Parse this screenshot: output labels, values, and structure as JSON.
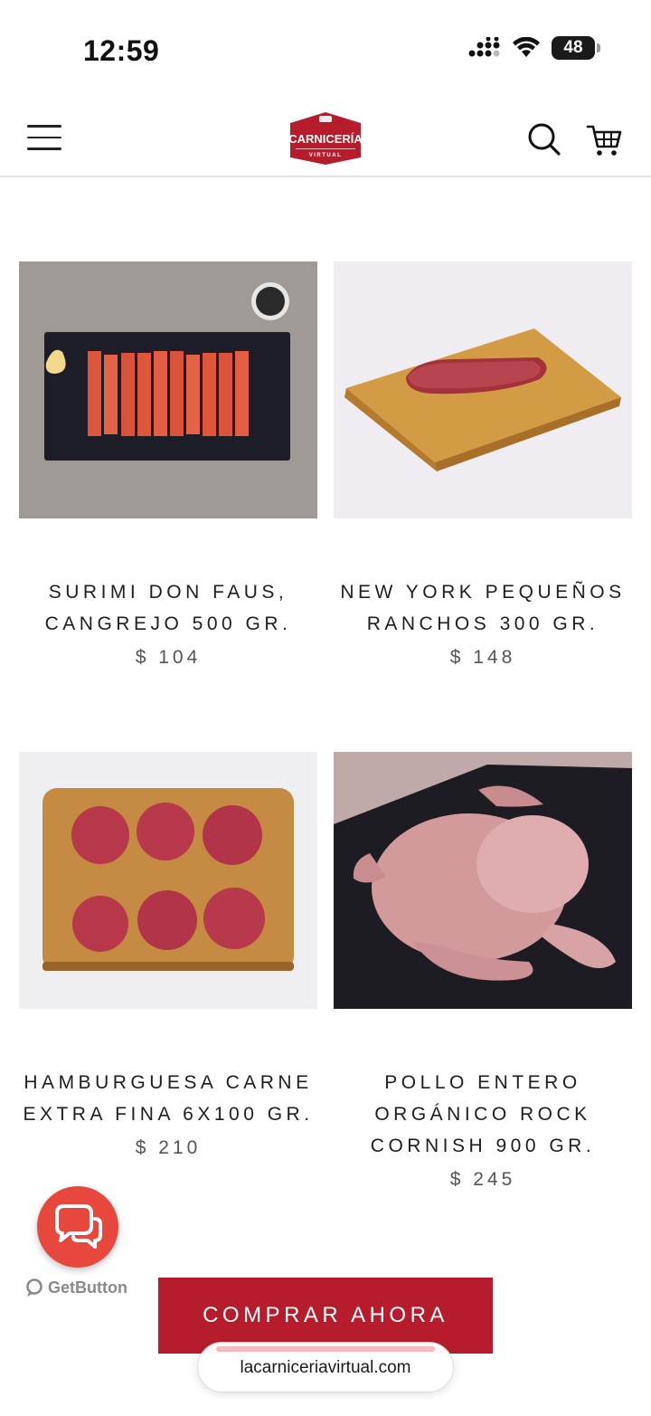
{
  "status_bar": {
    "time": "12:59",
    "battery": "48"
  },
  "header": {
    "menu_icon": "hamburger-menu-icon",
    "logo_text": "CARNICERÍA",
    "logo_subtext": "VIRTUAL",
    "search_icon": "search-icon",
    "cart_icon": "cart-icon",
    "brand_color": "#b71c2c"
  },
  "products": [
    {
      "name": "SURIMI DON FAUS, CANGREJO 500 GR.",
      "price": "$ 104"
    },
    {
      "name": "NEW YORK PEQUEÑOS RANCHOS 300 GR.",
      "price": "$ 148"
    },
    {
      "name": "HAMBURGUESA CARNE EXTRA FINA 6X100 GR.",
      "price": "$ 210"
    },
    {
      "name": "POLLO ENTERO ORGÁNICO ROCK CORNISH 900 GR.",
      "price": "$ 245"
    }
  ],
  "chat_widget": {
    "icon": "chat-bubbles-icon",
    "label": "GetButton",
    "color": "#e8473e"
  },
  "cta": {
    "label": "COMPRAR AHORA"
  },
  "browser": {
    "url": "lacarniceriavirtual.com"
  }
}
